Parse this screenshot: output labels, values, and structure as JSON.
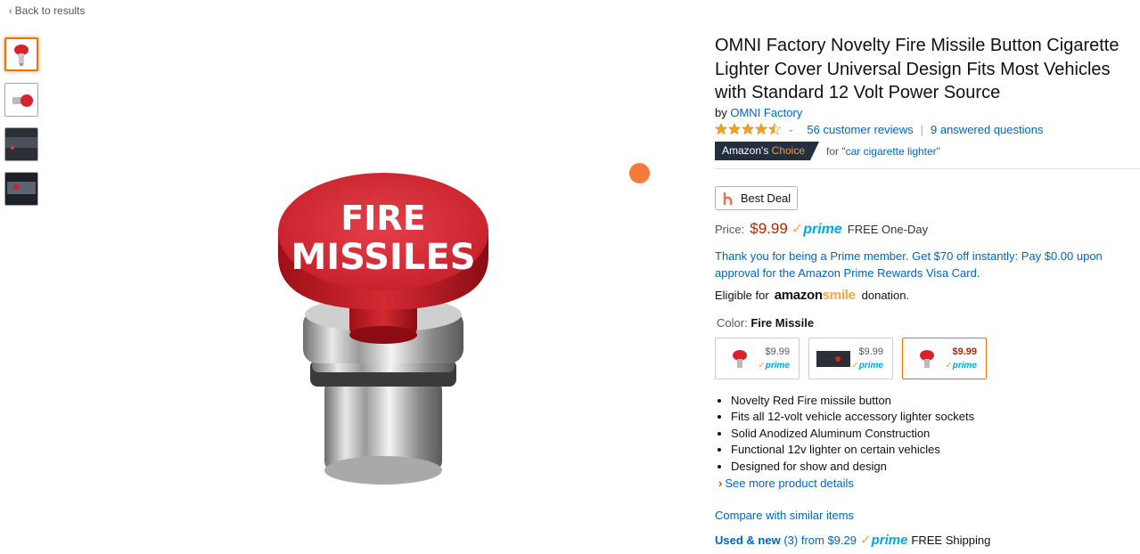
{
  "nav": {
    "back_label": "Back to results"
  },
  "product": {
    "title": "OMNI Factory Novelty Fire Missile Button Cigarette Lighter Cover Universal Design Fits Most Vehicles with Standard 12 Volt Power Source",
    "by_prefix": "by",
    "brand": "OMNI Factory",
    "rating_stars": 4.5,
    "reviews_label": "56 customer reviews",
    "questions_label": "9 answered questions",
    "button_text_line1": "FIRE",
    "button_text_line2": "MISSILES"
  },
  "badge": {
    "amazons": "Amazon's",
    "choice": "Choice",
    "for_prefix": "for",
    "for_query": "\"car cigarette lighter\""
  },
  "deal": {
    "label": "Best Deal"
  },
  "price": {
    "label": "Price:",
    "value": "$9.99",
    "prime": "prime",
    "shipping": "FREE One-Day"
  },
  "promo": {
    "text": "Thank you for being a Prime member. Get $70 off instantly: Pay $0.00 upon approval for the Amazon Prime Rewards Visa Card."
  },
  "smile": {
    "prefix": "Eligible for",
    "amazon": "amazon",
    "smile": "smile",
    "suffix": "donation."
  },
  "color": {
    "label": "Color:",
    "selected": "Fire Missile",
    "swatches": [
      {
        "price": "$9.99",
        "prime": "prime"
      },
      {
        "price": "$9.99",
        "prime": "prime"
      },
      {
        "price": "$9.99",
        "prime": "prime"
      }
    ]
  },
  "bullets": [
    "Novelty Red Fire missile button",
    "Fits all 12-volt vehicle accessory lighter sockets",
    "Solid Anodized Aluminum Construction",
    "Functional 12v lighter on certain vehicles",
    "Designed for show and design"
  ],
  "see_more": "See more product details",
  "compare": "Compare with similar items",
  "used": {
    "label": "Used & new",
    "count": "(3)",
    "from": "from $9.29",
    "prime": "prime",
    "shipping": "FREE Shipping"
  },
  "colors": {
    "link": "#0066c0",
    "price": "#b12704",
    "accent": "#e77600",
    "badge_bg": "#232f3e",
    "prime": "#00a8e1"
  }
}
